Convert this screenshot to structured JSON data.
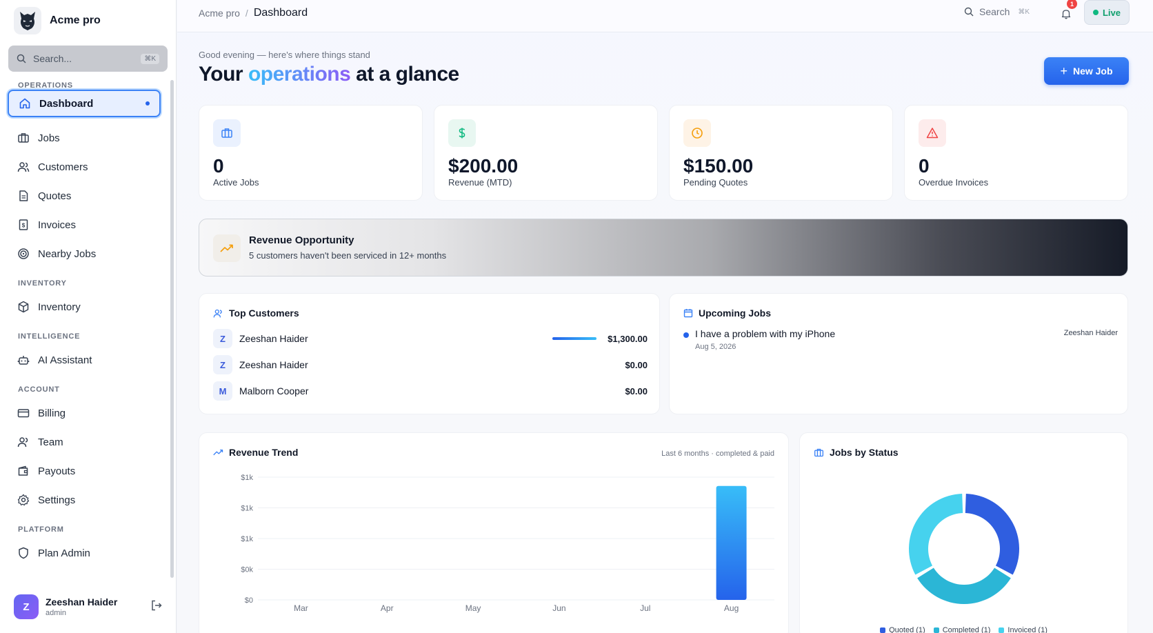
{
  "app": {
    "name": "Acme pro"
  },
  "sidebar": {
    "search_placeholder": "Search...",
    "search_shortcut": "⌘K",
    "sections": [
      {
        "label": "OPERATIONS"
      },
      {
        "label": "INVENTORY"
      },
      {
        "label": "INTELLIGENCE"
      },
      {
        "label": "ACCOUNT"
      },
      {
        "label": "PLATFORM"
      }
    ],
    "items": [
      {
        "label": "Dashboard",
        "icon": "home-icon"
      },
      {
        "label": "Jobs",
        "icon": "briefcase-icon"
      },
      {
        "label": "Customers",
        "icon": "users-icon"
      },
      {
        "label": "Quotes",
        "icon": "document-icon"
      },
      {
        "label": "Invoices",
        "icon": "invoice-icon"
      },
      {
        "label": "Nearby Jobs",
        "icon": "target-icon"
      },
      {
        "label": "Inventory",
        "icon": "box-icon"
      },
      {
        "label": "AI Assistant",
        "icon": "bot-icon"
      },
      {
        "label": "Billing",
        "icon": "card-icon"
      },
      {
        "label": "Team",
        "icon": "team-icon"
      },
      {
        "label": "Payouts",
        "icon": "wallet-icon"
      },
      {
        "label": "Settings",
        "icon": "gear-icon"
      },
      {
        "label": "Plan Admin",
        "icon": "shield-icon"
      }
    ],
    "user": {
      "initial": "Z",
      "name": "Zeeshan Haider",
      "role": "admin"
    }
  },
  "header": {
    "breadcrumb_root": "Acme pro",
    "breadcrumb_sep": "/",
    "breadcrumb_current": "Dashboard",
    "search_label": "Search",
    "search_shortcut": "⌘K",
    "notifications": "1",
    "status_label": "Live"
  },
  "hero": {
    "greeting": "Good evening — here's where things stand",
    "title_pre": "Your ",
    "title_highlight": "operations",
    "title_post": " at a glance",
    "new_job_label": "New Job"
  },
  "stats": [
    {
      "value": "0",
      "label": "Active Jobs",
      "icon": "briefcase-icon",
      "color": "#3b82f6"
    },
    {
      "value": "$200.00",
      "label": "Revenue (MTD)",
      "icon": "dollar-icon",
      "color": "#10b981"
    },
    {
      "value": "$150.00",
      "label": "Pending Quotes",
      "icon": "clock-icon",
      "color": "#f59e0b"
    },
    {
      "value": "0",
      "label": "Overdue Invoices",
      "icon": "alert-icon",
      "color": "#ef4444"
    }
  ],
  "opportunity": {
    "title": "Revenue Opportunity",
    "subtitle": "5 customers haven't been serviced in 12+ months"
  },
  "top_customers": {
    "title": "Top Customers",
    "rows": [
      {
        "initial": "Z",
        "name": "Zeeshan Haider",
        "amount": "$1,300.00",
        "share": 1.0
      },
      {
        "initial": "Z",
        "name": "Zeeshan Haider",
        "amount": "$0.00",
        "share": 0
      },
      {
        "initial": "M",
        "name": "Malborn Cooper",
        "amount": "$0.00",
        "share": 0
      }
    ]
  },
  "upcoming_jobs": {
    "title": "Upcoming Jobs",
    "rows": [
      {
        "title": "I have a problem with my iPhone",
        "date": "Aug 5, 2026",
        "assignee": "Zeeshan Haider"
      }
    ]
  },
  "revenue_trend": {
    "title": "Revenue Trend",
    "meta": "Last 6 months · completed & paid"
  },
  "jobs_by_status": {
    "title": "Jobs by Status"
  },
  "chart_data": [
    {
      "type": "bar",
      "title": "Revenue Trend",
      "categories": [
        "Mar",
        "Apr",
        "May",
        "Jun",
        "Jul",
        "Aug"
      ],
      "values": [
        0,
        0,
        0,
        0,
        0,
        1300
      ],
      "ytick_labels": [
        "$0",
        "$0k",
        "$1k",
        "$1k",
        "$1k"
      ],
      "ytick_values": [
        0,
        350,
        700,
        1050,
        1400
      ],
      "ylim": [
        0,
        1400
      ],
      "grid": true,
      "colors": [
        "#2563eb",
        "#38bdf8"
      ]
    },
    {
      "type": "pie",
      "title": "Jobs by Status",
      "labels": [
        "Quoted (1)",
        "Completed (1)",
        "Invoiced (1)"
      ],
      "values": [
        1,
        1,
        1
      ],
      "colors": [
        "#2f5ee0",
        "#2bb6d6",
        "#46d2ee"
      ],
      "legend": "bottom"
    }
  ]
}
